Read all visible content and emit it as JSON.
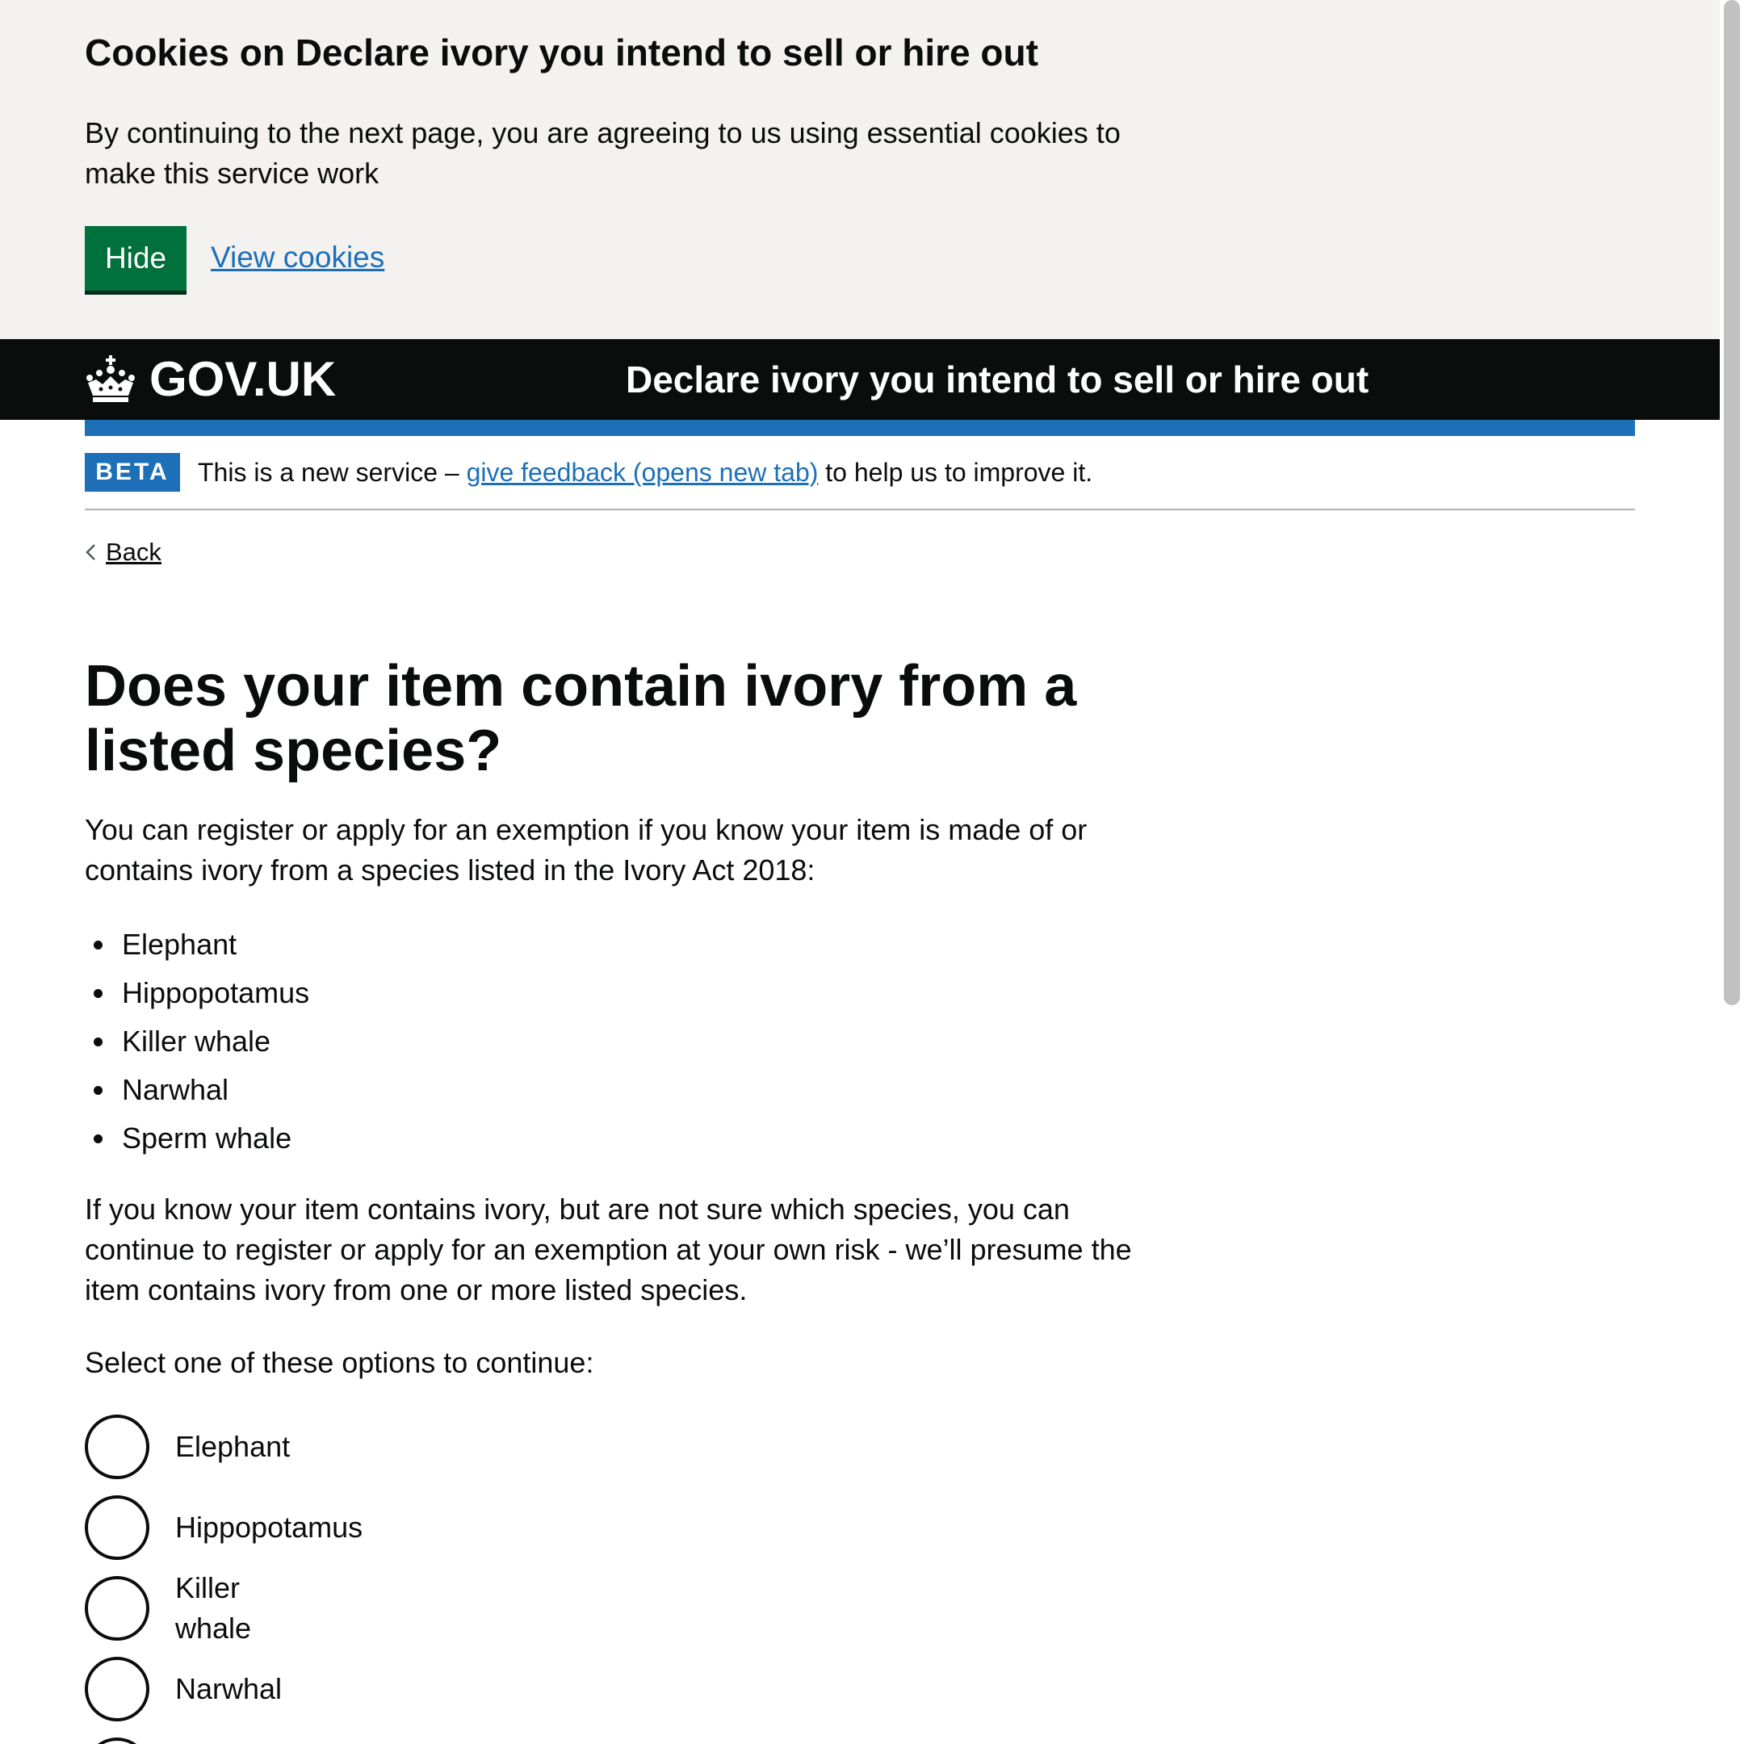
{
  "cookie_banner": {
    "title": "Cookies on Declare ivory you intend to sell or hire out",
    "text": "By continuing to the next page, you are agreeing to us using essential cookies to make this service work",
    "hide_label": "Hide",
    "view_cookies_label": "View cookies"
  },
  "header": {
    "logo_text": "GOV.UK",
    "logo_icon": "crown-icon",
    "service_name": "Declare ivory you intend to sell or hire out"
  },
  "phase_banner": {
    "tag": "BETA",
    "text_before": "This is a new service – ",
    "feedback_link": "give feedback (opens new tab)",
    "text_after": " to help us to improve it."
  },
  "back_link": {
    "label": "Back",
    "icon": "chevron-left-icon"
  },
  "main": {
    "heading": "Does your item contain ivory from a listed species?",
    "intro": "You can register or apply for an exemption if you know your item is made of or contains ivory from a species listed in the Ivory Act 2018:",
    "species": [
      "Elephant",
      "Hippopotamus",
      "Killer whale",
      "Narwhal",
      "Sperm whale"
    ],
    "note": "If you know your item contains ivory, but are not sure which species, you can continue to register or apply for an exemption at your own risk - we’ll presume the item contains ivory from one or more listed species.",
    "select_hint": "Select one of these options to continue:",
    "options": [
      {
        "label": "Elephant",
        "checked": false
      },
      {
        "label": "Hippopotamus",
        "checked": false
      },
      {
        "label": "Killer whale",
        "checked": false
      },
      {
        "label": "Narwhal",
        "checked": false
      },
      {
        "label": "",
        "checked": false
      }
    ]
  },
  "colors": {
    "link": "#1d70b8",
    "button_green": "#00703c",
    "header_black": "#0b0c0c",
    "banner_grey": "#f3f2f1",
    "beta_blue": "#1d70b8"
  }
}
